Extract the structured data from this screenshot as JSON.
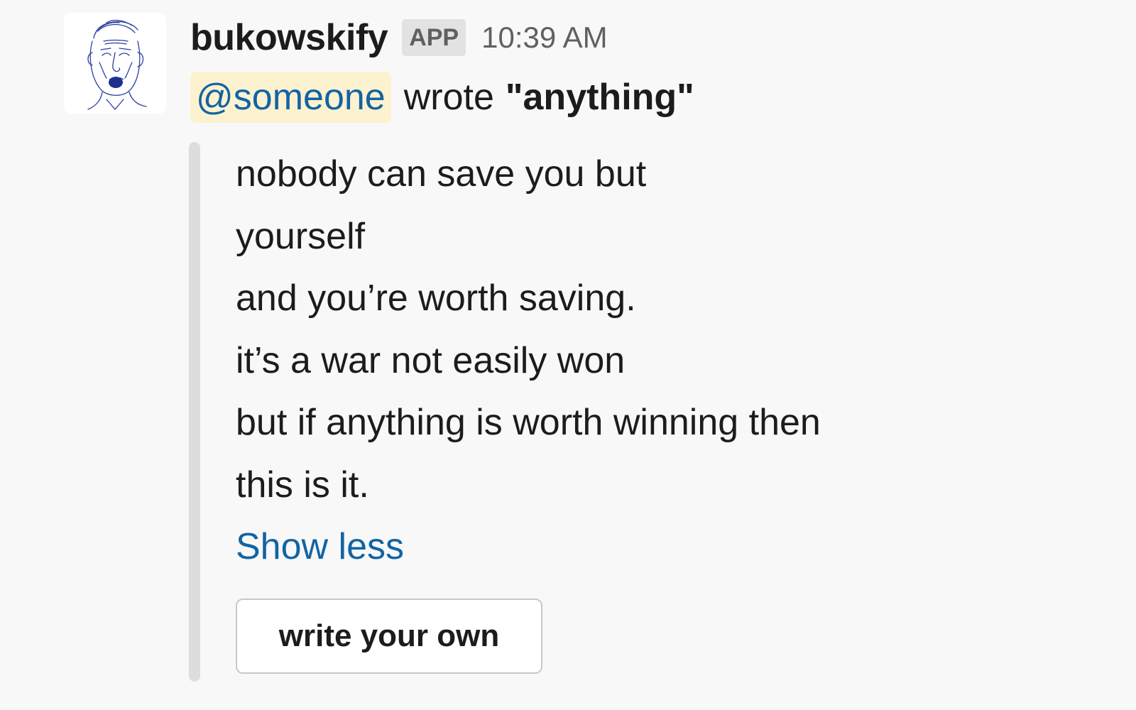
{
  "message": {
    "avatar_icon": "bukowski-sketch-portrait-icon",
    "sender": "bukowskify",
    "badge": "APP",
    "timestamp": "10:39 AM",
    "mention": "@someone",
    "wrote_text": "wrote",
    "quoted_word": "\"anything\""
  },
  "attachment": {
    "bar_color": "#dddddd",
    "poem_lines": [
      "nobody can save you but",
      "yourself",
      "and you’re worth saving.",
      "it’s a war not easily won",
      "but if anything is worth winning then",
      "this is it."
    ],
    "show_less_label": "Show less",
    "button_label": "write your own"
  },
  "colors": {
    "link": "#1264a3",
    "mention_bg": "#fdf2d0",
    "avatar_ink": "#2b3fa0",
    "background": "#f8f8f8"
  }
}
